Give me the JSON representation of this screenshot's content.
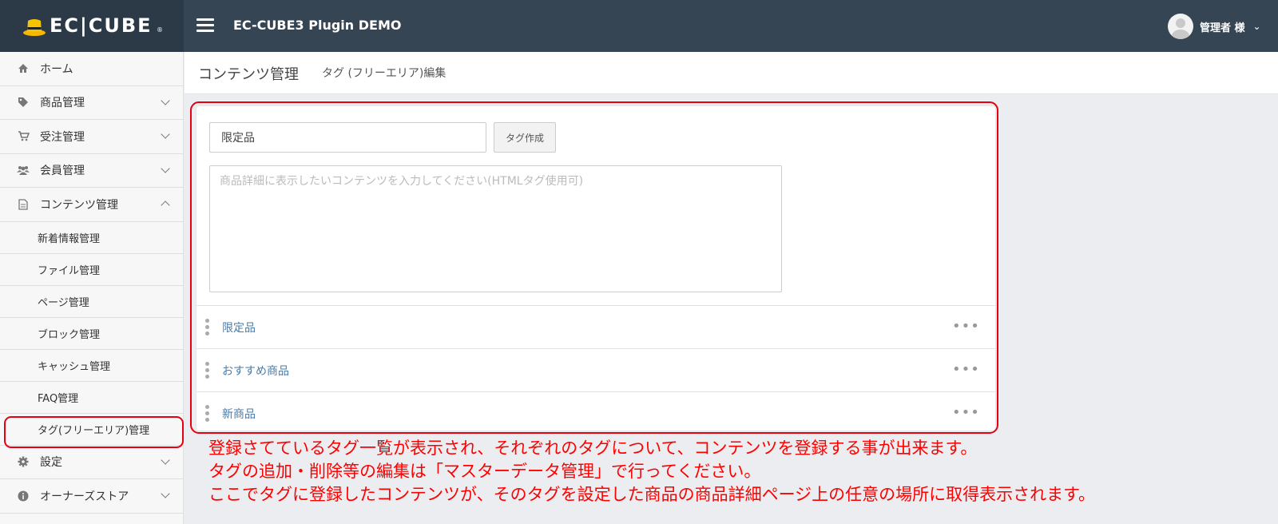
{
  "header": {
    "logo_text": "EC|CUBE",
    "logo_mark": "®",
    "site_title": "EC-CUBE3 Plugin DEMO",
    "user_name": "管理者 様"
  },
  "sidebar": {
    "items": [
      {
        "label": "ホーム",
        "icon": "home-icon"
      },
      {
        "label": "商品管理",
        "icon": "tag-icon"
      },
      {
        "label": "受注管理",
        "icon": "cart-icon"
      },
      {
        "label": "会員管理",
        "icon": "users-icon"
      },
      {
        "label": "コンテンツ管理",
        "icon": "file-icon"
      }
    ],
    "sub_items": [
      {
        "label": "新着情報管理"
      },
      {
        "label": "ファイル管理"
      },
      {
        "label": "ページ管理"
      },
      {
        "label": "ブロック管理"
      },
      {
        "label": "キャッシュ管理"
      },
      {
        "label": "FAQ管理"
      },
      {
        "label": "タグ(フリーエリア)管理"
      }
    ],
    "bottom_items": [
      {
        "label": "設定",
        "icon": "gear-icon"
      },
      {
        "label": "オーナーズストア",
        "icon": "info-icon"
      }
    ]
  },
  "page": {
    "title": "コンテンツ管理",
    "subtitle": "タグ (フリーエリア)編集"
  },
  "form": {
    "tag_input_value": "限定品",
    "create_button": "タグ作成",
    "content_placeholder": "商品詳細に表示したいコンテンツを入力してください(HTMLタグ使用可)"
  },
  "tags": [
    {
      "name": "限定品"
    },
    {
      "name": "おすすめ商品"
    },
    {
      "name": "新商品"
    }
  ],
  "row_menu_label": "•••",
  "notes": [
    "登録さてているタグ一覧が表示され、それぞれのタグについて、コンテンツを登録する事が出来ます。",
    "タグの追加・削除等の編集は「マスターデータ管理」で行ってください。",
    "ここでタグに登録したコンテンツが、そのタグを設定した商品の商品詳細ページ上の任意の場所に取得表示されます。"
  ],
  "colors": {
    "header_bg": "#364553",
    "logo_bg": "#2c3a47",
    "annotation_red": "#e60012",
    "link_blue": "#4a7ba6"
  }
}
